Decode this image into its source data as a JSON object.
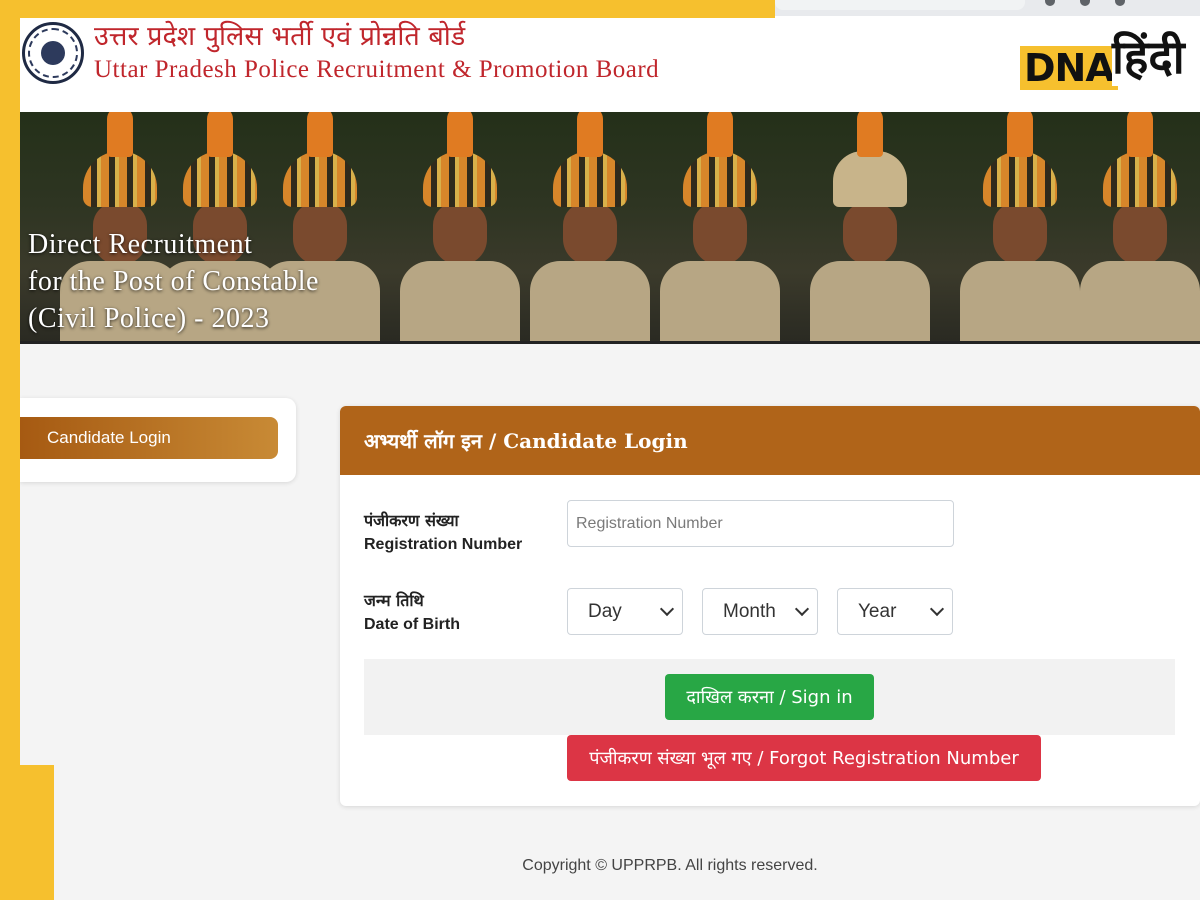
{
  "header": {
    "title_hindi": "उत्तर प्रदेश पुलिस भर्ती एवं प्रोन्नति बोर्ड",
    "title_english": "Uttar Pradesh Police Recruitment & Promotion Board",
    "emblem_icon": "up-police-emblem-icon"
  },
  "watermark": {
    "brand_latin": "DNA",
    "brand_hindi": "हिंदी"
  },
  "banner": {
    "line1": "Direct Recruitment",
    "line2": "for the Post of Constable",
    "line3": "(Civil Police) - 2023"
  },
  "sidebar": {
    "items": [
      {
        "label": "Candidate Login"
      }
    ]
  },
  "login": {
    "title": "अभ्यर्थी लॉग इन / Candidate Login",
    "registration": {
      "label_hindi": "पंजीकरण संख्या",
      "label_english": "Registration Number",
      "placeholder": "Registration Number",
      "value": ""
    },
    "dob": {
      "label_hindi": "जन्म तिथि",
      "label_english": "Date of Birth",
      "day": "Day",
      "month": "Month",
      "year": "Year"
    },
    "signin_label": "दाखिल करना / Sign in",
    "forgot_label": "पंजीकरण संख्या भूल गए / Forgot Registration Number"
  },
  "footer": {
    "copyright": "Copyright © UPPRPB. All rights reserved."
  },
  "colors": {
    "accent_brown": "#b06419",
    "title_red": "#c0262c",
    "signin_green": "#28a745",
    "forgot_red": "#dc3545",
    "frame_yellow": "#f6c02e"
  }
}
